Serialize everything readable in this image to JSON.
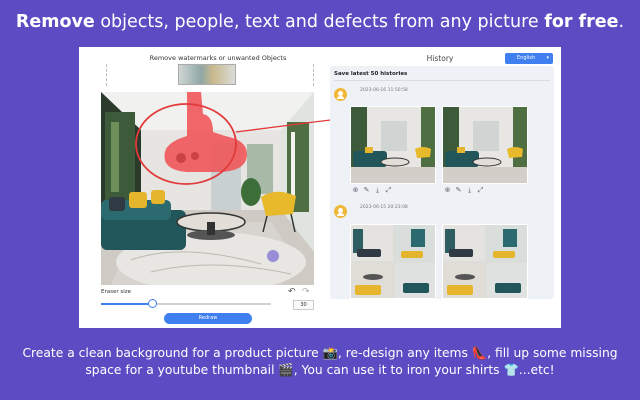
{
  "headline": {
    "part1": "Remove",
    "part2": " objects, people, text and defects from any picture ",
    "part3": "for free",
    "part4": "."
  },
  "editor": {
    "title": "Remove watermarks or unwanted Objects",
    "eraser_label": "Eraser size",
    "eraser_value": "30",
    "eraser_fraction": 0.3,
    "redraw_label": "Redraw",
    "undo_icon": "undo-icon",
    "redo_icon": "redo-icon"
  },
  "history": {
    "title": "History",
    "language": "English",
    "subtitle": "Save latest 50 histories",
    "entries": [
      {
        "timestamp": "2023-06-16 11:50:58"
      },
      {
        "timestamp": "2023-06-15 20:23:08"
      }
    ],
    "action_icons": [
      "zoom-icon",
      "edit-icon",
      "download-icon",
      "expand-icon"
    ]
  },
  "caption": {
    "line1": "Create a clean background for a product picture 📸, re-design any items 👠, fill up some missing",
    "line2": "space for a youtube thumbnail 🎬, You can use it to iron your shirts 👕...etc!"
  },
  "colors": {
    "background": "#5b4cc4",
    "accent": "#3f7ff0",
    "highlight": "#e23a3a",
    "mask": "#f0565a"
  }
}
